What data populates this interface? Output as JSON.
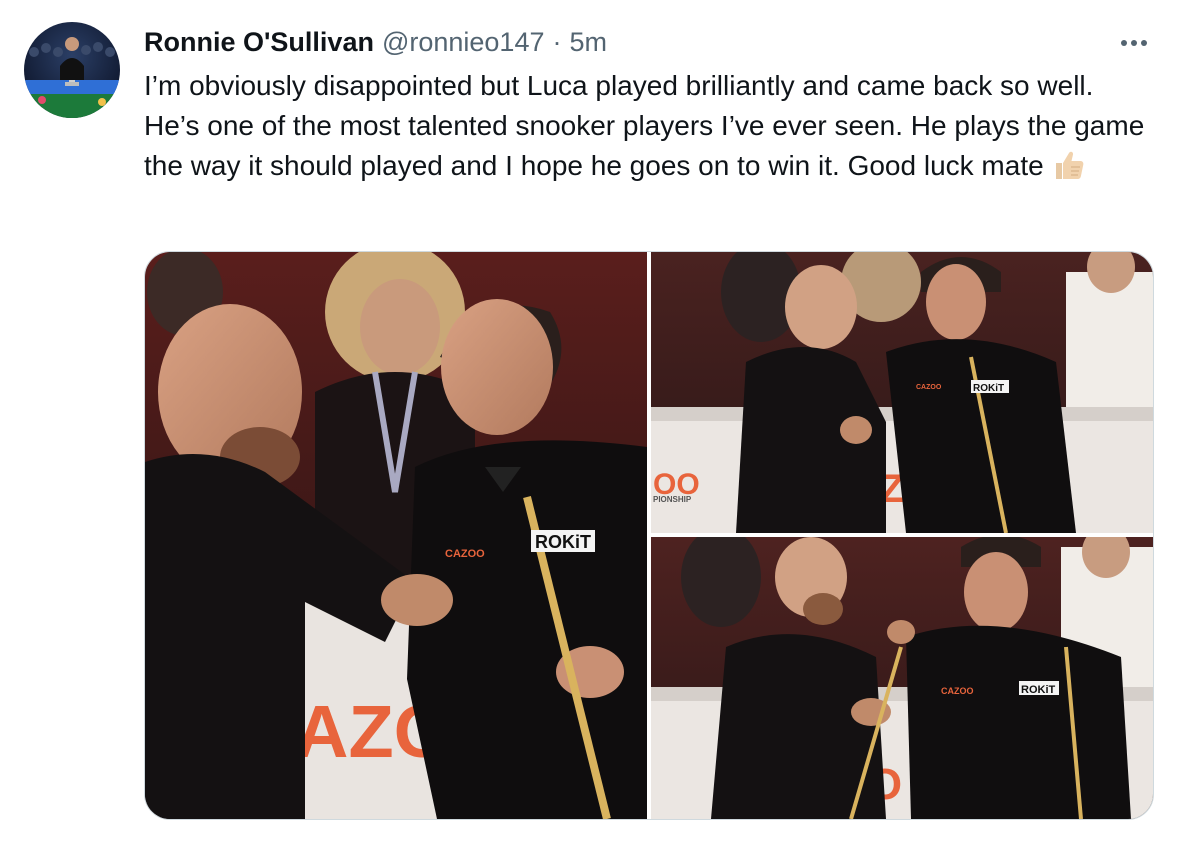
{
  "tweet": {
    "author_name": "Ronnie O'Sullivan",
    "author_handle": "@ronnieo147",
    "separator": "·",
    "time": "5m",
    "text": "I’m obviously disappointed but Luca played brilliantly and came back so well. He’s one of the most talented snooker players I’ve ever seen. He plays the game the way it should played and I hope he goes on to win it. Good luck mate",
    "emoji_icon": "thumbs-up-icon"
  },
  "media": {
    "photos": [
      {
        "sponsor_text": "AZO",
        "waistcoat_badge": "ROKiT",
        "waistcoat_logo": "CAZOO"
      },
      {
        "sponsor_text": "AZ",
        "banner_text": "OO",
        "banner_subtext": "PIONSHIP",
        "waistcoat_badge": "ROKiT",
        "waistcoat_logo": "CAZOO"
      },
      {
        "sponsor_text": "ZO",
        "waistcoat_badge": "ROKiT",
        "waistcoat_logo": "CAZOO"
      }
    ]
  },
  "colors": {
    "text_primary": "#0f1419",
    "text_secondary": "#536471",
    "border": "#cfd9de",
    "sponsor_orange": "#e8643c"
  }
}
